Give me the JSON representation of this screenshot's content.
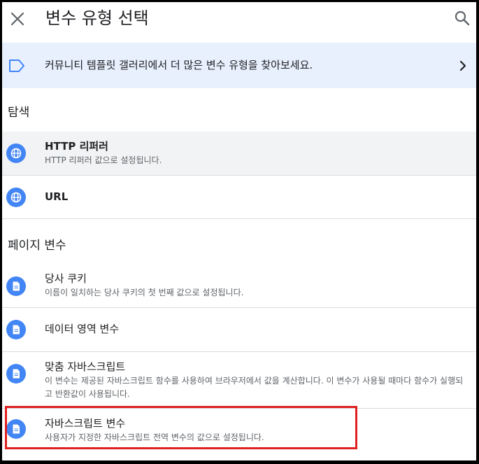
{
  "header": {
    "title": "변수 유형 선택",
    "close_icon": "close-icon",
    "search_icon": "search-icon"
  },
  "banner": {
    "text": "커뮤니티 템플릿 갤러리에서 더 많은 변수 유형을 찾아보세요.",
    "tag_icon": "tag-icon",
    "chevron_icon": "chevron-right-icon"
  },
  "sections": {
    "navigation": {
      "title": "탐색",
      "items": [
        {
          "name": "HTTP 리퍼러",
          "description": "HTTP 리퍼러 값으로 설정됩니다.",
          "icon": "globe-icon"
        },
        {
          "name": "URL",
          "description": "",
          "icon": "globe-icon"
        }
      ]
    },
    "page_variables": {
      "title": "페이지 변수",
      "items": [
        {
          "name": "당사 쿠키",
          "description": "이름이 일치하는 당사 쿠키의 첫 번째 값으로 설정됩니다.",
          "icon": "document-icon"
        },
        {
          "name": "데이터 영역 변수",
          "description": "",
          "icon": "document-icon"
        },
        {
          "name": "맞춤 자바스크립트",
          "description": "이 변수는 제공된 자바스크립트 함수를 사용하여 브라우저에서 값을 계산합니다. 이 변수가 사용될 때마다 함수가 실행되고 반환값이 사용됩니다.",
          "icon": "document-icon"
        },
        {
          "name": "자바스크립트 변수",
          "description": "사용자가 지정한 자바스크립트 전역 변수의 값으로 설정됩니다.",
          "icon": "document-icon"
        }
      ]
    }
  },
  "colors": {
    "accent": "#4285f4",
    "banner_bg": "#e8f0fe",
    "highlight": "#e02020"
  }
}
